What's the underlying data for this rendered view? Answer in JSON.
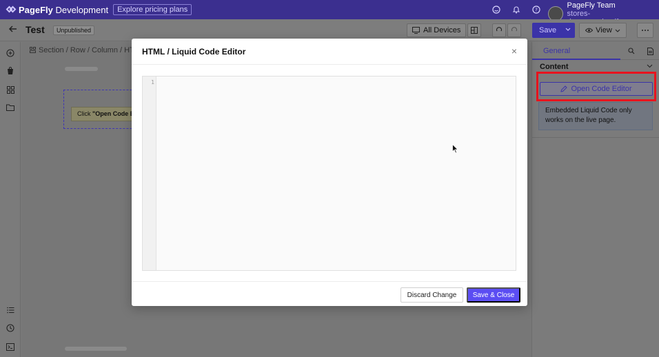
{
  "brand": {
    "name_bold": "PageFly",
    "name_rest": " Development",
    "pricing_label": "Explore pricing plans"
  },
  "top_icons": [
    "smile-icon",
    "bell-icon",
    "help-icon"
  ],
  "user": {
    "name": "PageFly Team",
    "store": "stores-demo.myshopify.com"
  },
  "toolbar": {
    "page_name": "Test",
    "status": "Unpublished",
    "devices_label": "All Devices",
    "save_label": "Save",
    "view_label": "View"
  },
  "canvas": {
    "breadcrumb": "Section / Row / Column / HTML",
    "element_text_prefix": "Click ",
    "element_text_bold": "\"Open Code Editor\""
  },
  "right_panel": {
    "tab_general": "General",
    "section_title": "Content",
    "open_editor_label": "Open Code Editor",
    "info_text": "Embedded Liquid Code only works on the live page."
  },
  "modal": {
    "title": "HTML / Liquid Code Editor",
    "close_glyph": "×",
    "line_number": "1",
    "discard_label": "Discard Change",
    "save_close_label": "Save & Close"
  },
  "colors": {
    "brand_purple": "#3b2f8f",
    "accent": "#5b4df3",
    "highlight": "#e8141e"
  }
}
